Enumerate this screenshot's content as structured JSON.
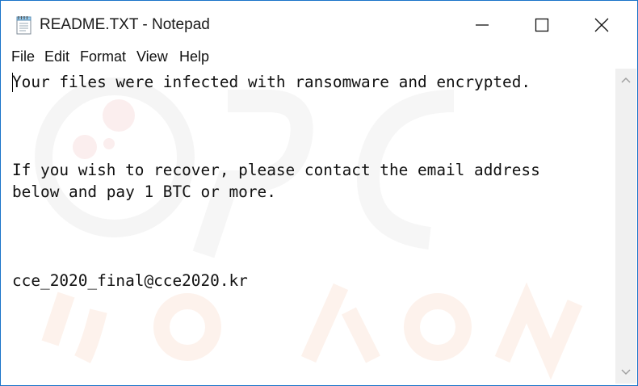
{
  "window": {
    "title": "README.TXT - Notepad"
  },
  "menu": {
    "file": "File",
    "edit": "Edit",
    "format": "Format",
    "view": "View",
    "help": "Help"
  },
  "document": {
    "text": "Your files were infected with ransomware and encrypted.\n\n\n\nIf you wish to recover, please contact the email address\nbelow and pay 1 BTC or more.\n\n\n\ncce_2020_final@cce2020.kr"
  },
  "icons": {
    "app": "notepad-icon",
    "minimize": "minimize-icon",
    "maximize": "maximize-icon",
    "close": "close-icon",
    "scroll_up": "chevron-up-icon",
    "scroll_down": "chevron-down-icon"
  },
  "colors": {
    "window_border": "#1a73c9",
    "text": "#111111",
    "scrollbar": "#f0f0f0"
  }
}
